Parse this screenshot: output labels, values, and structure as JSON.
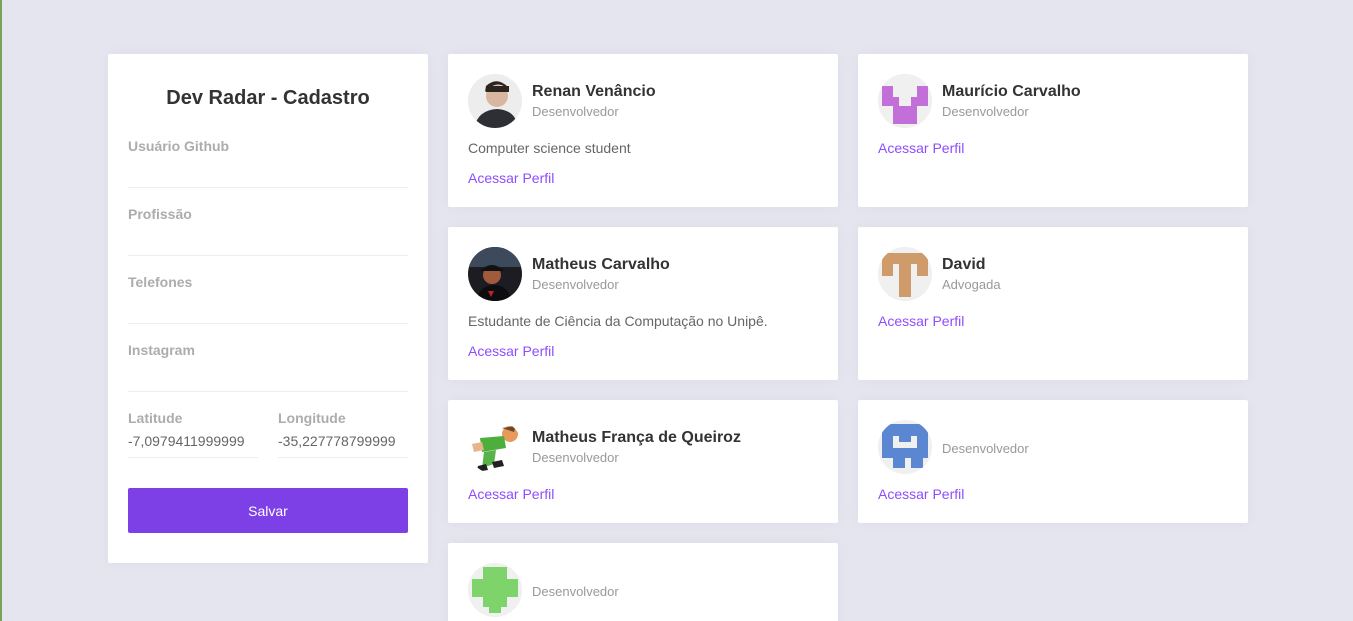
{
  "form": {
    "title": "Dev Radar - Cadastro",
    "github_label": "Usuário Github",
    "github_value": "",
    "profession_label": "Profissão",
    "profession_value": "",
    "phones_label": "Telefones",
    "phones_value": "",
    "instagram_label": "Instagram",
    "instagram_value": "",
    "latitude_label": "Latitude",
    "latitude_value": "-7,0979411999999",
    "longitude_label": "Longitude",
    "longitude_value": "-35,227778799999",
    "save_label": "Salvar"
  },
  "devs": [
    {
      "name": "Renan Venâncio",
      "techs": "Desenvolvedor",
      "bio": "Computer science student",
      "link": "Acessar Perfil"
    },
    {
      "name": "Maurício Carvalho",
      "techs": "Desenvolvedor",
      "bio": "",
      "link": "Acessar Perfil"
    },
    {
      "name": "Matheus Carvalho",
      "techs": "Desenvolvedor",
      "bio": "Estudante de Ciência da Computação no Unipê.",
      "link": "Acessar Perfil"
    },
    {
      "name": "David",
      "techs": "Advogada",
      "bio": "",
      "link": "Acessar Perfil"
    },
    {
      "name": "Matheus França de Queiroz",
      "techs": "Desenvolvedor",
      "bio": "",
      "link": "Acessar Perfil"
    },
    {
      "name": "",
      "techs": "Desenvolvedor",
      "bio": "",
      "link": "Acessar Perfil"
    },
    {
      "name": "",
      "techs": "Desenvolvedor",
      "bio": "",
      "link": ""
    }
  ],
  "colors": {
    "accent": "#7d40e7",
    "link": "#8e4dff",
    "background": "#e5e5ef"
  }
}
